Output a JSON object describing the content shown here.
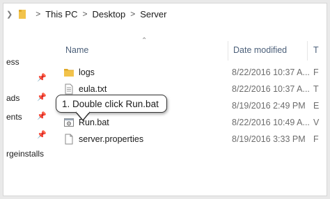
{
  "breadcrumb": {
    "items": [
      "This PC",
      "Desktop",
      "Server"
    ],
    "separator": ">"
  },
  "nav_pane": {
    "items": [
      {
        "label": "ess",
        "pinned": false
      },
      {
        "label": "",
        "pinned": true
      },
      {
        "label": "ads",
        "pinned": true
      },
      {
        "label": "ents",
        "pinned": true
      },
      {
        "label": "",
        "pinned": true
      },
      {
        "label": "rgeinstalls",
        "pinned": false
      }
    ]
  },
  "columns": {
    "name": "Name",
    "date_modified": "Date modified",
    "type": "T"
  },
  "files": [
    {
      "name": "logs",
      "date": "8/22/2016 10:37 A...",
      "type": "F",
      "icon": "folder-icon"
    },
    {
      "name": "eula.txt",
      "date": "8/22/2016 10:37 A...",
      "type": "T",
      "icon": "text-file-icon"
    },
    {
      "name": "",
      "date": "8/19/2016 2:49 PM",
      "type": "E",
      "icon": "file-icon"
    },
    {
      "name": "Run.bat",
      "date": "8/22/2016 10:49 A...",
      "type": "V",
      "icon": "batch-file-icon"
    },
    {
      "name": "server.properties",
      "date": "8/19/2016 3:33 PM",
      "type": "F",
      "icon": "file-icon"
    }
  ],
  "callout": {
    "text": "1. Double click Run.bat"
  },
  "colors": {
    "folder": "#f2c34b",
    "header_text": "#4c607a",
    "callout_border": "#333333"
  }
}
